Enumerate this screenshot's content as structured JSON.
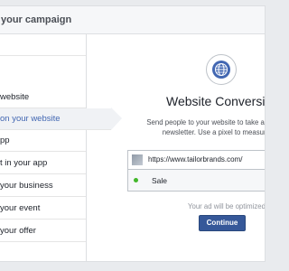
{
  "panel": {
    "title": "your campaign"
  },
  "sidebar": {
    "items": [
      {
        "label": ""
      },
      {
        "label": "website"
      },
      {
        "label": "on your website"
      },
      {
        "label": "pp"
      },
      {
        "label": "t in your app"
      },
      {
        "label": "your business"
      },
      {
        "label": "your event"
      },
      {
        "label": "your offer"
      }
    ]
  },
  "content": {
    "icon": "globe-icon",
    "title": "Website Conversion",
    "description_line1": "Send people to your website to take a specific actio",
    "description_line2": "newsletter. Use a pixel to measure your c",
    "url_value": "https://www.tailorbrands.com/",
    "event_label": "Sale",
    "note": "Your ad will be optimized for Sa",
    "continue_label": "Continue"
  },
  "colors": {
    "accent": "#4267b2",
    "button": "#365899",
    "status_dot": "#42b72a"
  }
}
